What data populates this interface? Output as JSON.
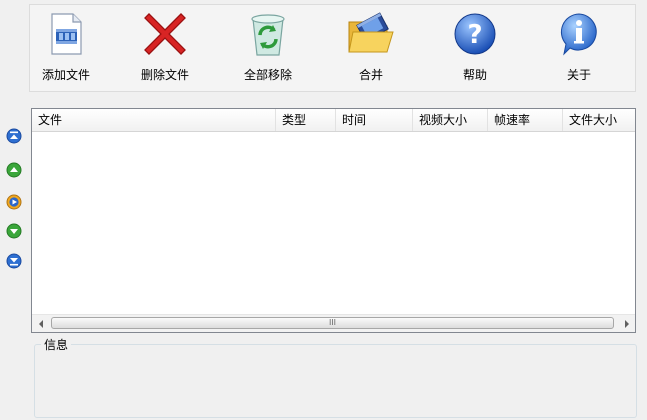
{
  "toolbar": {
    "add_files": "添加文件",
    "delete_files": "删除文件",
    "remove_all": "全部移除",
    "merge": "合并",
    "help": "帮助",
    "about": "关于"
  },
  "side_controls": [
    "move-top-icon",
    "move-up-icon",
    "play-icon",
    "move-down-icon",
    "move-bottom-icon"
  ],
  "list": {
    "columns": [
      "文件",
      "类型",
      "时间",
      "视频大小",
      "帧速率",
      "文件大小"
    ],
    "rows": []
  },
  "scrollbar": {
    "grip": "III"
  },
  "info": {
    "title": "信息",
    "text": ""
  },
  "colors": {
    "accent_blue": "#2e6fd1",
    "accent_green": "#3aa63a",
    "delete_red": "#c42020"
  }
}
